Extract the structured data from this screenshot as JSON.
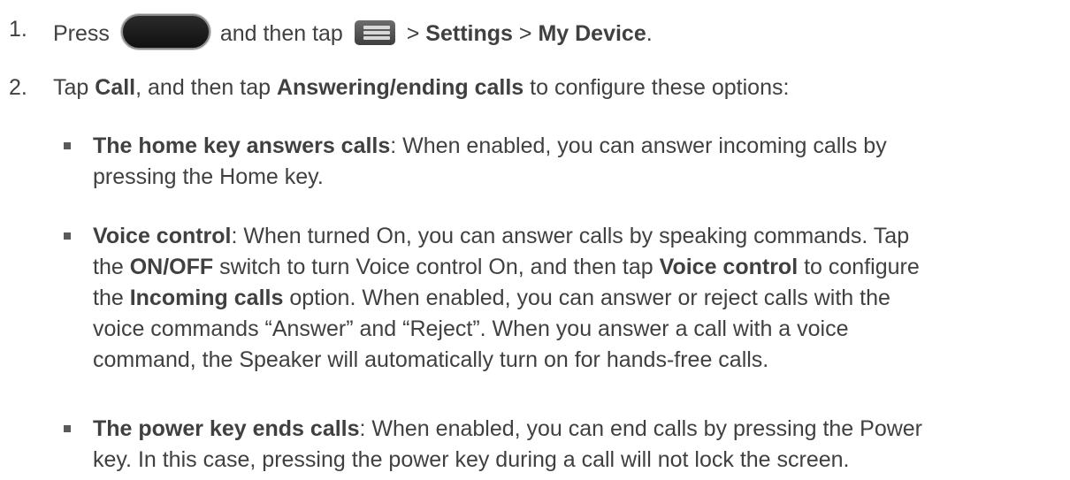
{
  "steps": [
    {
      "number": "1.",
      "parts": {
        "press": "Press",
        "and_then_tap": "and then tap",
        "sep1": ">",
        "settings": "Settings",
        "sep2": ">",
        "my_device": "My Device",
        "end": "."
      },
      "icons": [
        "home-key-icon",
        "menu-key-icon"
      ]
    },
    {
      "number": "2.",
      "parts": {
        "tap": "Tap",
        "call": "Call",
        "and_then_tap": ", and then tap",
        "answering": "Answering/ending calls",
        "rest": "to configure these options:"
      }
    }
  ],
  "options": [
    {
      "title": "The home key answers calls",
      "lines": [
        ": When enabled, you can answer incoming calls by",
        "pressing the Home key."
      ]
    },
    {
      "title": "Voice control",
      "segments": {
        "s1": ": When turned On, you can answer calls by speaking commands. Tap",
        "s2": "the",
        "onoff": "ON/OFF",
        "s3": "switch to turn Voice control On, and then tap",
        "voice_control": "Voice control",
        "s4": "to configure",
        "s5": "the",
        "incoming": "Incoming calls",
        "s6": "option. When enabled, you can answer or reject calls with the",
        "s7": "voice commands “Answer” and “Reject”. When you answer a call with a voice",
        "s8": "command, the Speaker will automatically turn on for hands-free calls."
      }
    },
    {
      "title": "The power key ends calls",
      "lines": [
        ": When enabled, you can end calls by pressing the Power",
        "key. In this case, pressing the power key during a call will not lock the screen."
      ]
    }
  ]
}
